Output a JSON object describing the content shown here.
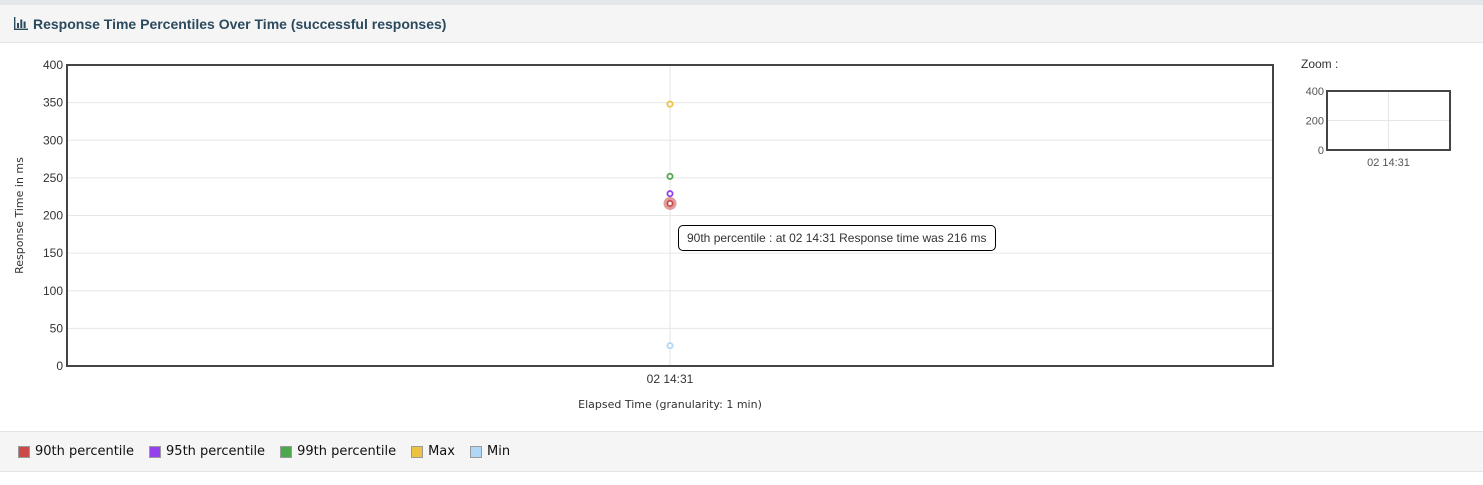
{
  "panel": {
    "title": "Response Time Percentiles Over Time (successful responses)",
    "icon": "bar-chart-icon"
  },
  "chart_data": {
    "type": "scatter",
    "x": [
      "02 14:31"
    ],
    "series": [
      {
        "name": "90th percentile",
        "color": "#cb4b4b",
        "values": [
          216
        ]
      },
      {
        "name": "95th percentile",
        "color": "#9440ed",
        "values": [
          229
        ]
      },
      {
        "name": "99th percentile",
        "color": "#4da74d",
        "values": [
          252
        ]
      },
      {
        "name": "Max",
        "color": "#edc240",
        "values": [
          348
        ]
      },
      {
        "name": "Min",
        "color": "#afd8f8",
        "values": [
          27
        ]
      }
    ],
    "xlabel": "Elapsed Time (granularity: 1 min)",
    "ylabel": "Response Time in ms",
    "ylim": [
      0,
      400
    ],
    "yticks": [
      "0",
      "50",
      "100",
      "150",
      "200",
      "250",
      "300",
      "350",
      "400"
    ],
    "grid": true,
    "legend_placement": "bottom",
    "highlighted_series": "90th percentile",
    "tooltip": "90th percentile : at 02 14:31 Response time was 216 ms"
  },
  "zoom": {
    "label": "Zoom :",
    "yticks": [
      "0",
      "200",
      "400"
    ],
    "ylim": [
      0,
      400
    ],
    "xtick": "02 14:31"
  }
}
